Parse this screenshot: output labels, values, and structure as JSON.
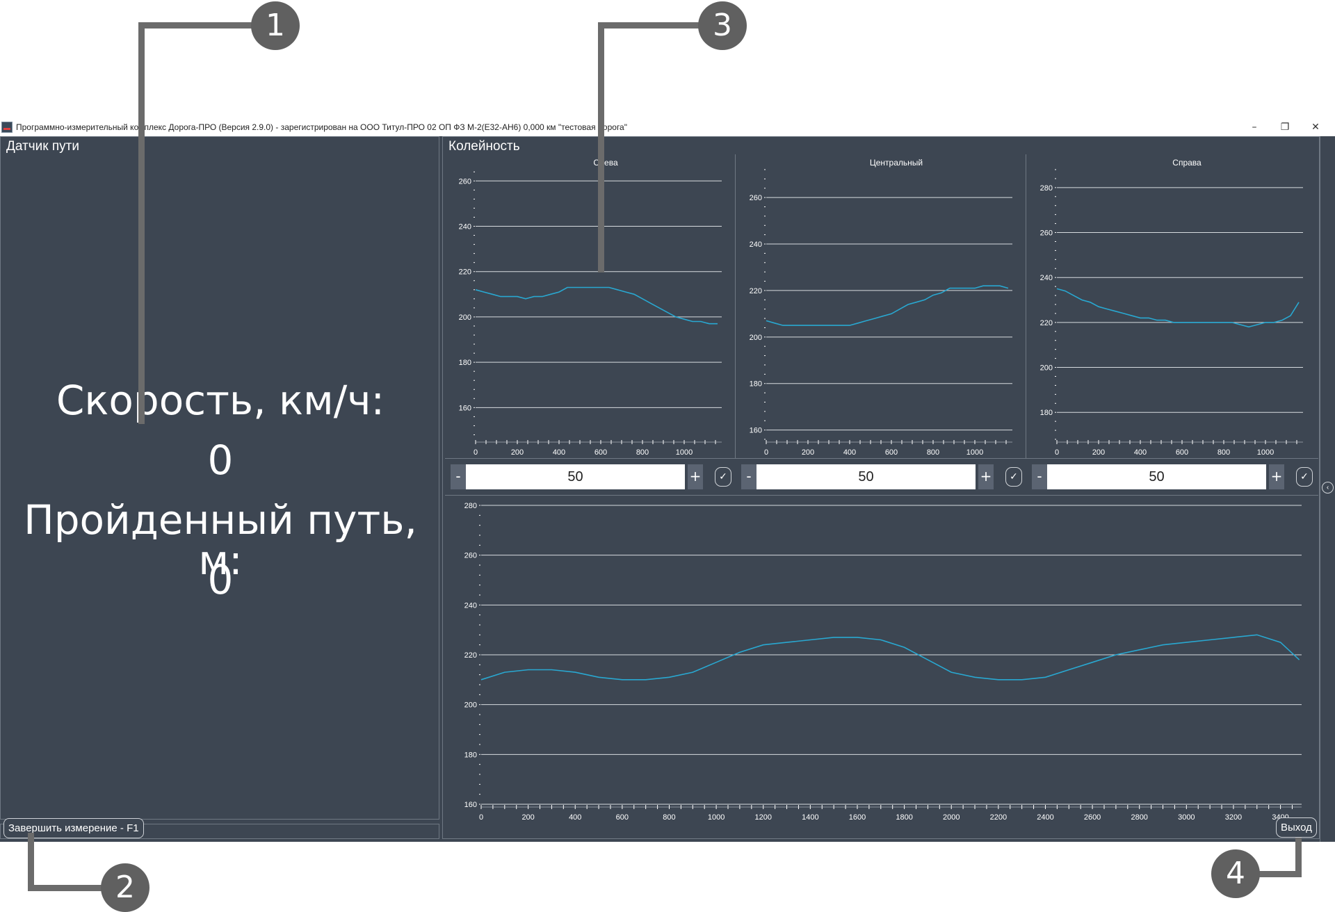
{
  "window": {
    "title": "Программно-измерительный комплекс Дорога-ПРО (Версия 2.9.0) - зарегистрирован на ООО Титул-ПРО 02 ОП ФЗ М-2(Е32-АН6) 0,000 км \"тестовая дорога\"",
    "minimize": "–",
    "restore": "❐",
    "close": "✕"
  },
  "left_panel": {
    "title": "Датчик пути",
    "speed_label": "Скорость, км/ч:",
    "speed_value": "0",
    "distance_label": "Пройденный путь, м:",
    "distance_value": "0",
    "finish_button": "Завершить измерение - F1"
  },
  "right_panel": {
    "title": "Колейность",
    "exit_button": "Выход",
    "collapse_icon": "‹"
  },
  "steppers": [
    {
      "minus": "-",
      "value": "50",
      "plus": "+",
      "confirm": "✓"
    },
    {
      "minus": "-",
      "value": "50",
      "plus": "+",
      "confirm": "✓"
    },
    {
      "minus": "-",
      "value": "50",
      "plus": "+",
      "confirm": "✓"
    }
  ],
  "callouts": [
    "1",
    "2",
    "3",
    "4"
  ],
  "colors": {
    "background": "#3d4652",
    "line": "#29a8d1",
    "grid": "#d8dce0",
    "callout": "#606060"
  },
  "chart_data": [
    {
      "type": "line",
      "title": "Слева",
      "xticks": [
        0,
        200,
        400,
        600,
        800,
        1000
      ],
      "yticks": [
        160,
        180,
        200,
        220,
        240,
        260
      ],
      "xlim": [
        0,
        1180
      ],
      "ylim": [
        146,
        265
      ],
      "series": [
        {
          "x": [
            0,
            40,
            80,
            120,
            160,
            200,
            240,
            280,
            320,
            360,
            400,
            440,
            480,
            520,
            560,
            600,
            640,
            680,
            720,
            760,
            800,
            840,
            880,
            920,
            960,
            1000,
            1040,
            1080,
            1120,
            1160
          ],
          "y": [
            212,
            211,
            210,
            209,
            209,
            209,
            208,
            209,
            209,
            210,
            211,
            213,
            213,
            213,
            213,
            213,
            213,
            212,
            211,
            210,
            208,
            206,
            204,
            202,
            200,
            199,
            198,
            198,
            197,
            197
          ]
        }
      ]
    },
    {
      "type": "line",
      "title": "Центральный",
      "xticks": [
        0,
        200,
        400,
        600,
        800,
        1000
      ],
      "yticks": [
        160,
        180,
        200,
        220,
        240,
        260
      ],
      "xlim": [
        0,
        1180
      ],
      "ylim": [
        156,
        272
      ],
      "series": [
        {
          "x": [
            0,
            40,
            80,
            120,
            160,
            200,
            240,
            280,
            320,
            360,
            400,
            440,
            480,
            520,
            560,
            600,
            640,
            680,
            720,
            760,
            800,
            840,
            880,
            920,
            960,
            1000,
            1040,
            1080,
            1120,
            1160
          ],
          "y": [
            207,
            206,
            205,
            205,
            205,
            205,
            205,
            205,
            205,
            205,
            205,
            206,
            207,
            208,
            209,
            210,
            212,
            214,
            215,
            216,
            218,
            219,
            221,
            221,
            221,
            221,
            222,
            222,
            222,
            221
          ]
        }
      ]
    },
    {
      "type": "line",
      "title": "Справа",
      "xticks": [
        0,
        200,
        400,
        600,
        800,
        1000
      ],
      "yticks": [
        180,
        200,
        220,
        240,
        260,
        280
      ],
      "xlim": [
        0,
        1180
      ],
      "ylim": [
        168,
        288
      ],
      "series": [
        {
          "x": [
            0,
            40,
            80,
            120,
            160,
            200,
            240,
            280,
            320,
            360,
            400,
            440,
            480,
            520,
            560,
            600,
            640,
            680,
            720,
            760,
            800,
            840,
            880,
            920,
            960,
            1000,
            1040,
            1080,
            1120,
            1160
          ],
          "y": [
            235,
            234,
            232,
            230,
            229,
            227,
            226,
            225,
            224,
            223,
            222,
            222,
            221,
            221,
            220,
            220,
            220,
            220,
            220,
            220,
            220,
            220,
            219,
            218,
            219,
            220,
            220,
            221,
            223,
            229
          ]
        }
      ]
    },
    {
      "type": "line",
      "title": "",
      "xticks": [
        0,
        200,
        400,
        600,
        800,
        1000,
        1200,
        1400,
        1600,
        1800,
        2000,
        2200,
        2400,
        2600,
        2800,
        3000,
        3200,
        3400
      ],
      "yticks": [
        160,
        180,
        200,
        220,
        240,
        260,
        280
      ],
      "xlim": [
        0,
        3490
      ],
      "ylim": [
        160,
        280
      ],
      "series": [
        {
          "x": [
            0,
            100,
            200,
            300,
            400,
            500,
            600,
            700,
            800,
            900,
            1000,
            1100,
            1200,
            1300,
            1400,
            1500,
            1600,
            1700,
            1800,
            1900,
            2000,
            2100,
            2200,
            2300,
            2400,
            2500,
            2600,
            2700,
            2800,
            2900,
            3000,
            3100,
            3200,
            3300,
            3400,
            3480
          ],
          "y": [
            210,
            213,
            214,
            214,
            213,
            211,
            210,
            210,
            211,
            213,
            217,
            221,
            224,
            225,
            226,
            227,
            227,
            226,
            223,
            218,
            213,
            211,
            210,
            210,
            211,
            214,
            217,
            220,
            222,
            224,
            225,
            226,
            227,
            228,
            225,
            218
          ]
        }
      ]
    }
  ]
}
